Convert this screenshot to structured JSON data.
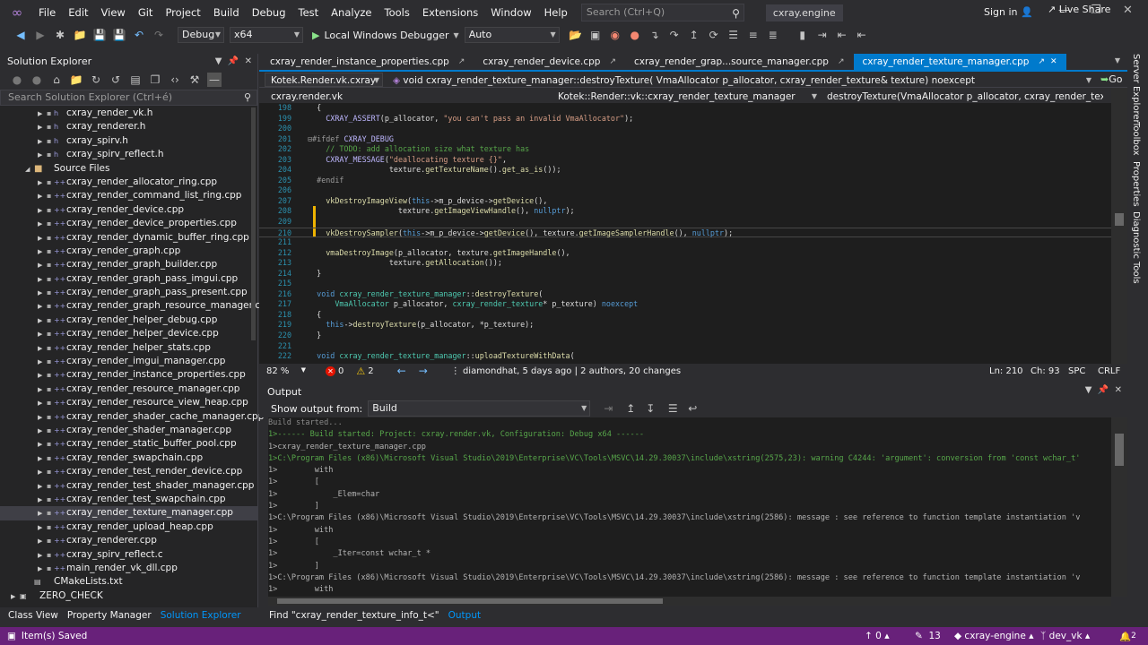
{
  "menubar": {
    "items": [
      "File",
      "Edit",
      "View",
      "Git",
      "Project",
      "Build",
      "Debug",
      "Test",
      "Analyze",
      "Tools",
      "Extensions",
      "Window",
      "Help"
    ],
    "search_placeholder": "Search (Ctrl+Q)",
    "solution_name": "cxray.engine",
    "signin": "Sign in"
  },
  "toolbar": {
    "config": "Debug",
    "platform": "x64",
    "debugger": "Local Windows Debugger",
    "attach": "Auto",
    "live_share": "Live Share"
  },
  "solution_explorer": {
    "title": "Solution Explorer",
    "search_placeholder": "Search Solution Explorer (Ctrl+é)",
    "items": [
      {
        "label": "cxray_render_vk.h",
        "kind": "h",
        "level": 3
      },
      {
        "label": "cxray_renderer.h",
        "kind": "h",
        "level": 3
      },
      {
        "label": "cxray_spirv.h",
        "kind": "h",
        "level": 3
      },
      {
        "label": "cxray_spirv_reflect.h",
        "kind": "h",
        "level": 3
      },
      {
        "label": "Source Files",
        "kind": "folder",
        "level": 2
      },
      {
        "label": "cxray_render_allocator_ring.cpp",
        "kind": "cpp",
        "level": 3
      },
      {
        "label": "cxray_render_command_list_ring.cpp",
        "kind": "cpp",
        "level": 3
      },
      {
        "label": "cxray_render_device.cpp",
        "kind": "cpp",
        "level": 3
      },
      {
        "label": "cxray_render_device_properties.cpp",
        "kind": "cpp",
        "level": 3
      },
      {
        "label": "cxray_render_dynamic_buffer_ring.cpp",
        "kind": "cpp",
        "level": 3
      },
      {
        "label": "cxray_render_graph.cpp",
        "kind": "cpp",
        "level": 3
      },
      {
        "label": "cxray_render_graph_builder.cpp",
        "kind": "cpp",
        "level": 3
      },
      {
        "label": "cxray_render_graph_pass_imgui.cpp",
        "kind": "cpp",
        "level": 3
      },
      {
        "label": "cxray_render_graph_pass_present.cpp",
        "kind": "cpp",
        "level": 3
      },
      {
        "label": "cxray_render_graph_resource_manager.cpp",
        "kind": "cpp",
        "level": 3
      },
      {
        "label": "cxray_render_helper_debug.cpp",
        "kind": "cpp",
        "level": 3
      },
      {
        "label": "cxray_render_helper_device.cpp",
        "kind": "cpp",
        "level": 3
      },
      {
        "label": "cxray_render_helper_stats.cpp",
        "kind": "cpp",
        "level": 3
      },
      {
        "label": "cxray_render_imgui_manager.cpp",
        "kind": "cpp",
        "level": 3
      },
      {
        "label": "cxray_render_instance_properties.cpp",
        "kind": "cpp",
        "level": 3
      },
      {
        "label": "cxray_render_resource_manager.cpp",
        "kind": "cpp",
        "level": 3
      },
      {
        "label": "cxray_render_resource_view_heap.cpp",
        "kind": "cpp",
        "level": 3
      },
      {
        "label": "cxray_render_shader_cache_manager.cpp",
        "kind": "cpp",
        "level": 3
      },
      {
        "label": "cxray_render_shader_manager.cpp",
        "kind": "cpp",
        "level": 3
      },
      {
        "label": "cxray_render_static_buffer_pool.cpp",
        "kind": "cpp",
        "level": 3
      },
      {
        "label": "cxray_render_swapchain.cpp",
        "kind": "cpp",
        "level": 3
      },
      {
        "label": "cxray_render_test_render_device.cpp",
        "kind": "cpp",
        "level": 3
      },
      {
        "label": "cxray_render_test_shader_manager.cpp",
        "kind": "cpp",
        "level": 3
      },
      {
        "label": "cxray_render_test_swapchain.cpp",
        "kind": "cpp",
        "level": 3
      },
      {
        "label": "cxray_render_texture_manager.cpp",
        "kind": "cpp",
        "level": 3,
        "selected": true
      },
      {
        "label": "cxray_render_upload_heap.cpp",
        "kind": "cpp",
        "level": 3
      },
      {
        "label": "cxray_renderer.cpp",
        "kind": "cpp",
        "level": 3
      },
      {
        "label": "cxray_spirv_reflect.c",
        "kind": "cpp",
        "level": 3
      },
      {
        "label": "main_render_vk_dll.cpp",
        "kind": "cpp",
        "level": 3
      },
      {
        "label": "CMakeLists.txt",
        "kind": "txt",
        "level": 2
      },
      {
        "label": "ZERO_CHECK",
        "kind": "project",
        "level": 1
      }
    ]
  },
  "editor": {
    "tabs": [
      {
        "label": "cxray_render_instance_properties.cpp",
        "active": false
      },
      {
        "label": "cxray_render_device.cpp",
        "active": false
      },
      {
        "label": "cxray_render_grap...source_manager.cpp",
        "active": false
      },
      {
        "label": "cxray_render_texture_manager.cpp",
        "active": true
      }
    ],
    "nav1": {
      "project": "Kotek.Render.vk.cxray",
      "scope": "void cxray_render_texture_manager::destroyTexture( VmaAllocator p_allocator, cxray_render_texture& texture) noexcept",
      "go": "Go"
    },
    "nav2": {
      "file": "cxray.render.vk",
      "class": "Kotek::Render::vk::cxray_render_texture_manager",
      "member": "destroyTexture(VmaAllocator p_allocator, cxray_render_texture &"
    },
    "zoom": "82 %",
    "errors": "0",
    "warnings": "2",
    "git_info": "diamondhat, 5 days ago | 2 authors, 20 changes",
    "line": "Ln: 210",
    "col": "Ch: 93",
    "spc": "SPC",
    "eol": "CRLF"
  },
  "output": {
    "title": "Output",
    "show_from_label": "Show output from:",
    "source": "Build",
    "lines": [
      "Build started...",
      "1>------ Build started: Project: cxray.render.vk, Configuration: Debug x64 ------",
      "1>cxray_render_texture_manager.cpp",
      "1>C:\\Program Files (x86)\\Microsoft Visual Studio\\2019\\Enterprise\\VC\\Tools\\MSVC\\14.29.30037\\include\\xstring(2575,23): warning C4244: 'argument': conversion from 'const wchar_t'",
      "1>        with",
      "1>        [",
      "1>            _Elem=char",
      "1>        ]",
      "1>C:\\Program Files (x86)\\Microsoft Visual Studio\\2019\\Enterprise\\VC\\Tools\\MSVC\\14.29.30037\\include\\xstring(2586): message : see reference to function template instantiation 'v",
      "1>        with",
      "1>        [",
      "1>            _Iter=const wchar_t *",
      "1>        ]",
      "1>C:\\Program Files (x86)\\Microsoft Visual Studio\\2019\\Enterprise\\VC\\Tools\\MSVC\\14.29.30037\\include\\xstring(2586): message : see reference to function template instantiation 'v",
      "1>        with"
    ]
  },
  "bottom_tabs": {
    "left": [
      "Class View",
      "Property Manager",
      "Solution Explorer"
    ],
    "find": "Find \"cxray_render_texture_info_t<\"",
    "output": "Output"
  },
  "side_tools": [
    "Server Explorer",
    "Toolbox",
    "Properties",
    "Diagnostic Tools"
  ],
  "statusbar": {
    "message": "Item(s) Saved",
    "up_count": "0",
    "pencil_count": "13",
    "repo": "cxray-engine",
    "branch": "dev_vk",
    "notifications": "2"
  },
  "colors": {
    "accent": "#007acc",
    "status_bar": "#68217a",
    "editor_bg": "#1e1e1e"
  }
}
